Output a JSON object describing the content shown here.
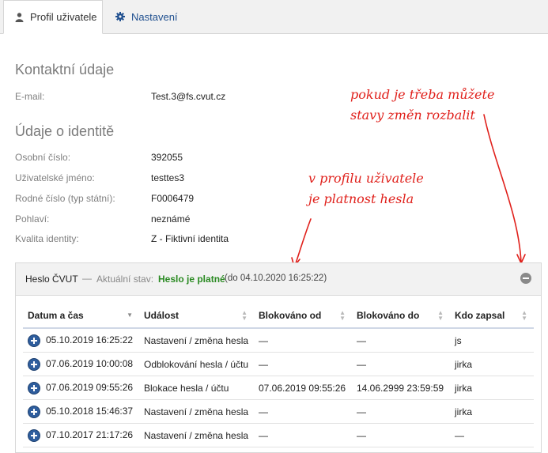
{
  "tabs": {
    "profile": "Profil uživatele",
    "settings": "Nastavení"
  },
  "contact": {
    "title": "Kontaktní údaje",
    "email_label": "E-mail:",
    "email_value": "Test.3@fs.cvut.cz"
  },
  "identity": {
    "title": "Údaje o identitě",
    "rows": [
      {
        "label": "Osobní číslo:",
        "value": "392055"
      },
      {
        "label": "Uživatelské jméno:",
        "value": "testtes3"
      },
      {
        "label": "Rodné číslo (typ státní):",
        "value": "F0006479"
      },
      {
        "label": "Pohlaví:",
        "value": "neznámé"
      },
      {
        "label": "Kvalita identity:",
        "value": "Z - Fiktivní identita"
      }
    ]
  },
  "annotations": {
    "expand_note": [
      "pokud je třeba můžete",
      "stavy změn rozbalit"
    ],
    "validity_note": [
      "v profilu uživatele",
      "je platnost hesla"
    ]
  },
  "password_panel": {
    "title": "Heslo ČVUT",
    "separator": "—",
    "status_label": "Aktuální stav:",
    "status_value": "Heslo je platné",
    "status_until": "(do 04.10.2020 16:25:22)",
    "status_color": "#2a8a22",
    "columns": [
      "Datum a čas",
      "Událost",
      "Blokováno od",
      "Blokováno do",
      "Kdo zapsal"
    ],
    "rows": [
      [
        "05.10.2019 16:25:22",
        "Nastavení / změna hesla",
        "—",
        "—",
        "js"
      ],
      [
        "07.06.2019 10:00:08",
        "Odblokování hesla / účtu",
        "—",
        "—",
        "jirka"
      ],
      [
        "07.06.2019 09:55:26",
        "Blokace hesla / účtu",
        "07.06.2019 09:55:26",
        "14.06.2999 23:59:59",
        "jirka"
      ],
      [
        "05.10.2018 15:46:37",
        "Nastavení / změna hesla",
        "—",
        "—",
        "jirka"
      ],
      [
        "07.10.2017 21:17:26",
        "Nastavení / změna hesla",
        "—",
        "—",
        "—"
      ]
    ]
  }
}
